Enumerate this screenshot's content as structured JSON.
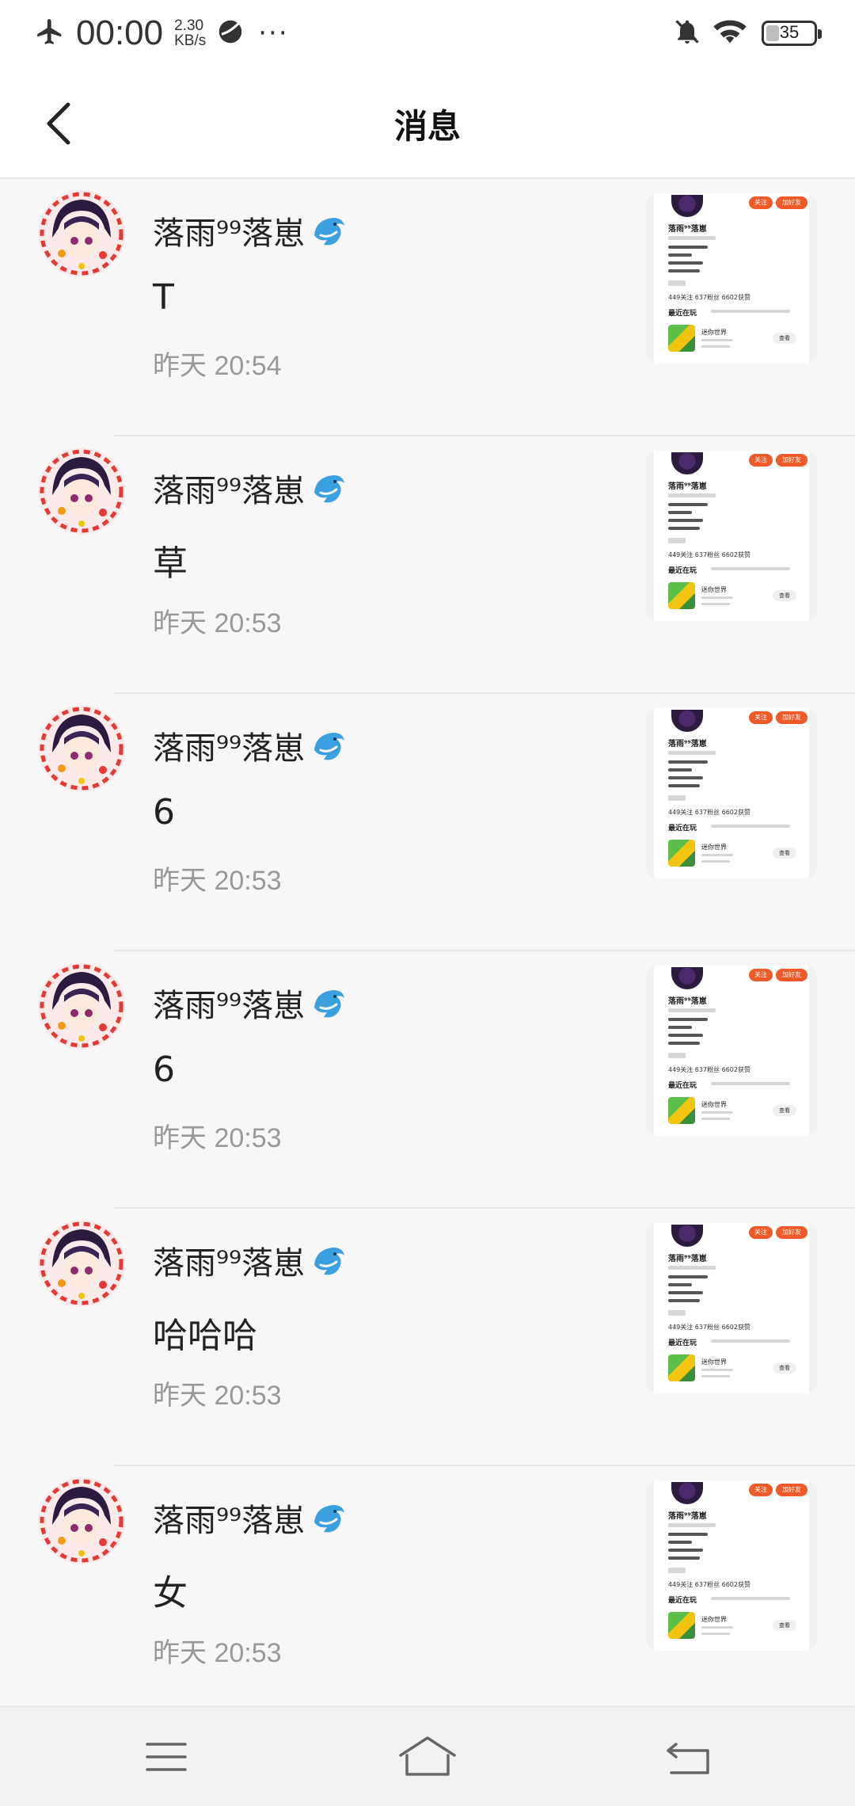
{
  "status_bar": {
    "time": "00:00",
    "speed_value": "2.30",
    "speed_unit": "KB/s",
    "more": "···",
    "battery": "35",
    "battery_level_percent": 35,
    "icons": [
      "airplane-mode-icon",
      "app-notification-icon",
      "mute-bell-icon",
      "wifi-icon",
      "battery-icon"
    ]
  },
  "header": {
    "title": "消息",
    "back_icon": "chevron-left-icon"
  },
  "messages": [
    {
      "sender": "落雨⁹⁹落崽",
      "text": "T",
      "time": "昨天 20:54"
    },
    {
      "sender": "落雨⁹⁹落崽",
      "text": "草",
      "time": "昨天 20:53"
    },
    {
      "sender": "落雨⁹⁹落崽",
      "text": "6",
      "time": "昨天 20:53"
    },
    {
      "sender": "落雨⁹⁹落崽",
      "text": "6",
      "time": "昨天 20:53"
    },
    {
      "sender": "落雨⁹⁹落崽",
      "text": "哈哈哈",
      "time": "昨天 20:53"
    },
    {
      "sender": "落雨⁹⁹落崽",
      "text": "女",
      "time": "昨天 20:53"
    }
  ],
  "thumbnail": {
    "name": "落雨⁹⁹落崽",
    "follow": "关注",
    "add_friend": "加好友",
    "stats": "449关注  637粉丝  6602获赞",
    "recent": "最近在玩",
    "game": "迷你世界",
    "view": "查看"
  },
  "nav_bar": {
    "icons": [
      "menu-icon",
      "home-icon",
      "back-icon"
    ]
  },
  "colors": {
    "accent_orange": "#f05a28",
    "dolphin_blue": "#3aa0e0",
    "time_gray": "#999999"
  }
}
